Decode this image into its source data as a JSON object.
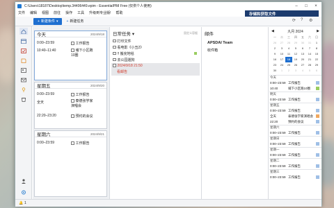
{
  "window": {
    "title": "C:\\Users\\18187\\Desktop\\temp.34406449.epim - EssentialPIM Free (仅供个人使用)",
    "menu": [
      "文件",
      "编辑",
      "视图",
      "前往",
      "操作",
      "工具",
      "升级到专业版!",
      "帮助"
    ],
    "banner": "存储和获取文件"
  },
  "toolbar": {
    "new_item": "新建条件",
    "new_todo": "新建任务"
  },
  "days": [
    {
      "label": "今天",
      "date": "2024/9/18",
      "rows": [
        {
          "time": "0:00–23:59",
          "text": "工作报告"
        },
        {
          "time": "10:40–11:40",
          "text": "埔下小区跑10圈"
        }
      ]
    },
    {
      "label": "星期五",
      "date": "2024/9/20",
      "rows": [
        {
          "time": "0:00–23:59",
          "text": "工作报告"
        },
        {
          "time": "全天",
          "text": "泰德张学家演唱会"
        },
        {
          "time": "22:20–23:20",
          "text": "预约的会议"
        }
      ]
    },
    {
      "label": "星期六",
      "date": "2024/9/21",
      "rows": [
        {
          "time": "0:00–23:59",
          "text": "工作报告"
        }
      ]
    }
  ],
  "tasks": {
    "header": "日常任务",
    "hint": "固定义容据",
    "items": [
      {
        "text": "打印文件"
      },
      {
        "text": "看电影《小丑2》"
      },
      {
        "text": "!! 搬完地毯"
      },
      {
        "text": "去公园遛狗"
      },
      {
        "text": "2024/9/18 21:50",
        "sub": "看邮告"
      }
    ]
  },
  "mail": {
    "header": "邮件",
    "folders": [
      "APSDAI Team",
      "收件箱"
    ]
  },
  "calendar": {
    "month_label": "九月  2024",
    "weekdays": [
      "一",
      "二",
      "三",
      "四",
      "五",
      "六",
      "日"
    ],
    "weeks": [
      [
        "26",
        "27",
        "28",
        "29",
        "30",
        "31",
        "1"
      ],
      [
        "2",
        "3",
        "4",
        "5",
        "6",
        "7",
        "8"
      ],
      [
        "9",
        "10",
        "11",
        "12",
        "13",
        "14",
        "15"
      ],
      [
        "16",
        "17",
        "18",
        "19",
        "20",
        "21",
        "22"
      ],
      [
        "23",
        "24",
        "25",
        "26",
        "27",
        "28",
        "29"
      ],
      [
        "30",
        "1",
        "2",
        "3",
        "4",
        "5",
        "6"
      ]
    ],
    "today": "18"
  },
  "agenda": [
    {
      "date": "今天"
    },
    {
      "time": "0:00–23:59",
      "text": "工作报告",
      "color": "#9fbfe6"
    },
    {
      "time": "10:40",
      "text": "埔下小区跑10圈",
      "color": "#9acd60"
    },
    {
      "date": "明天"
    },
    {
      "time": "0:00–23:59",
      "text": "工作报告",
      "color": "#9fbfe6"
    },
    {
      "date": "星期五"
    },
    {
      "time": "0:00–23:59",
      "text": "工作报告",
      "color": "#9fbfe6"
    },
    {
      "time": "全天",
      "text": "泰德张学家演唱会",
      "color": "#f0a860"
    },
    {
      "time": "22:20",
      "text": "预约的会议",
      "color": "#9fbfe6"
    },
    {
      "date": "星期六"
    },
    {
      "time": "0:00–23:59",
      "text": "工作报告",
      "color": "#9fbfe6"
    },
    {
      "date": "星期日"
    },
    {
      "time": "0:00–23:59",
      "text": "工作报告",
      "color": "#9fbfe6"
    },
    {
      "date": "星期一"
    },
    {
      "time": "0:00–23:59",
      "text": "工作报告",
      "color": "#9fbfe6"
    },
    {
      "date": "星期二"
    },
    {
      "time": "0:00–23:59",
      "text": "工作报告",
      "color": "#9fbfe6"
    },
    {
      "date": "星期三"
    },
    {
      "time": "0:00–23:59",
      "text": "工作报告",
      "color": "#9fbfe6"
    }
  ]
}
